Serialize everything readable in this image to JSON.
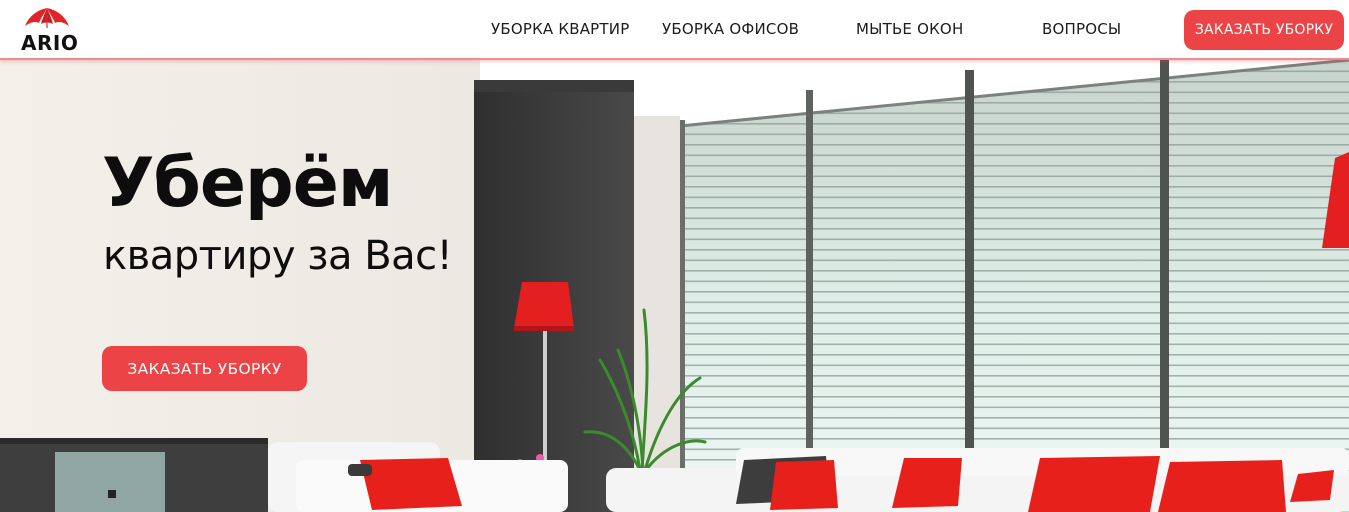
{
  "brand": {
    "logo_text": "ARIO"
  },
  "nav": {
    "items": [
      {
        "label": "УБОРКА КВАРТИР"
      },
      {
        "label": "УБОРКА ОФИСОВ"
      },
      {
        "label": "МЫТЬЕ ОКОН"
      },
      {
        "label": "ВОПРОСЫ"
      }
    ],
    "cta_label": "ЗАКАЗАТЬ УБОРКУ"
  },
  "hero": {
    "title": "Уберём",
    "subtitle": "квартиру за Вас!",
    "cta_label": "ЗАКАЗАТЬ УБОРКУ",
    "image": "living-room-photo"
  },
  "colors": {
    "accent": "#ec4346",
    "text": "#0d0d0d",
    "header_border": "#f08a8d"
  }
}
